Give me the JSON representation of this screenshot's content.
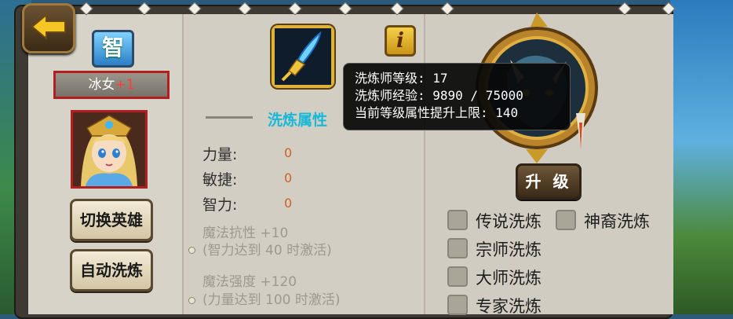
{
  "hero": {
    "attribute_badge": "智",
    "name": "冰女",
    "bonus": "+1"
  },
  "buttons": {
    "switch_hero": "切换英雄",
    "auto_wash": "自动洗炼",
    "upgrade": "升 级",
    "info": "i"
  },
  "wash": {
    "title": "洗炼属性",
    "stats": [
      {
        "label": "力量:",
        "value": "0"
      },
      {
        "label": "敏捷:",
        "value": "0"
      },
      {
        "label": "智力:",
        "value": "0"
      }
    ],
    "locked": [
      {
        "name": "魔法抗性  +10",
        "condition": "(智力达到  40  时激活)"
      },
      {
        "name": "魔法强度  +120",
        "condition": "(力量达到  100  时激活)"
      }
    ]
  },
  "tooltip": {
    "line1": "洗炼师等级: 17",
    "line2": "洗炼师经验: 9890 / 75000",
    "line3": "当前等级属性提升上限: 140"
  },
  "options": [
    {
      "label": "传说洗炼",
      "checked": false
    },
    {
      "label": "神裔洗炼",
      "checked": false
    },
    {
      "label": "宗师洗炼",
      "checked": false
    },
    {
      "label": "大师洗炼",
      "checked": false
    },
    {
      "label": "专家洗炼",
      "checked": false
    }
  ],
  "colors": {
    "accent_title": "#16b9d9",
    "stat_value": "#d2602a",
    "hero_bonus": "#ff3b3b",
    "badge_border": "#b02020"
  },
  "icons": {
    "back": "back-arrow-icon",
    "item": "ice-spear-icon",
    "emblem": "beast-emblem-icon",
    "portrait": "crystal-maiden-portrait"
  }
}
